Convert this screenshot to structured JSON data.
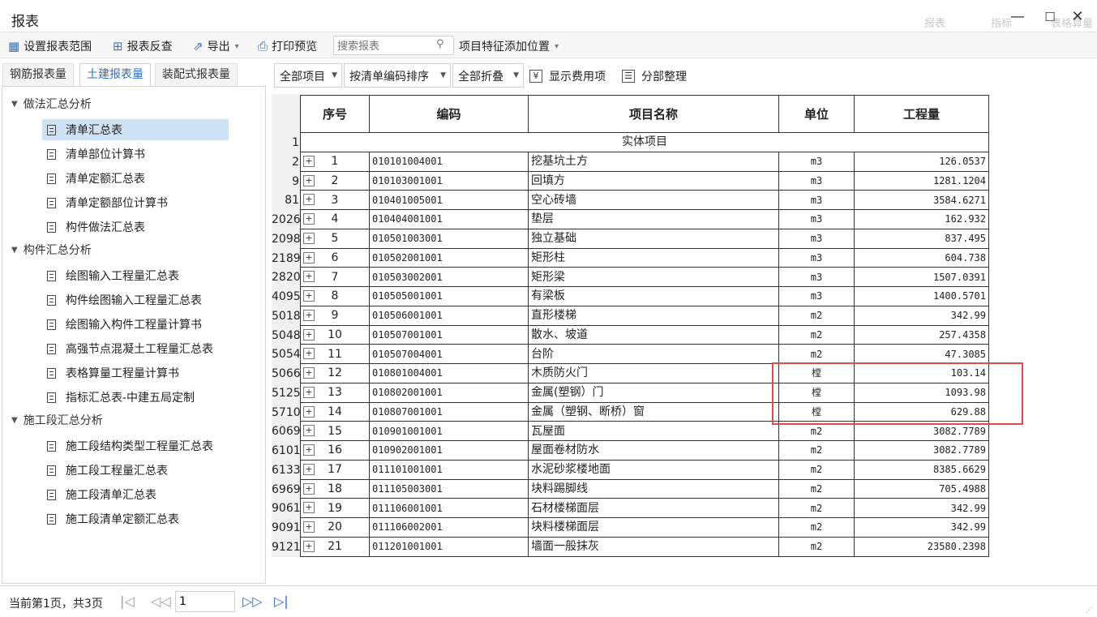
{
  "window": {
    "title": "报表",
    "faint_labels": [
      "报表",
      "指标",
      "表格算量"
    ],
    "minimize_symbol": "—",
    "maximize_symbol": "☐",
    "close_symbol": "✕"
  },
  "toolbar": {
    "set_range": "设置报表范围",
    "review": "报表反查",
    "export": "导出",
    "print_preview": "打印预览",
    "search_placeholder": "搜索报表",
    "add_feature_position": "项目特征添加位置"
  },
  "left_tabs": [
    {
      "label": "钢筋报表量",
      "active": false
    },
    {
      "label": "土建报表量",
      "active": true
    },
    {
      "label": "装配式报表量",
      "active": false
    }
  ],
  "tree": {
    "groups": [
      {
        "label": "做法汇总分析",
        "items": [
          "清单汇总表",
          "清单部位计算书",
          "清单定额汇总表",
          "清单定额部位计算书",
          "构件做法汇总表"
        ]
      },
      {
        "label": "构件汇总分析",
        "items": [
          "绘图输入工程量汇总表",
          "构件绘图输入工程量汇总表",
          "绘图输入构件工程量计算书",
          "高强节点混凝土工程量汇总表",
          "表格算量工程量计算书",
          "指标汇总表-中建五局定制"
        ]
      },
      {
        "label": "施工段汇总分析",
        "items": [
          "施工段结构类型工程量汇总表",
          "施工段工程量汇总表",
          "施工段清单汇总表",
          "施工段清单定额汇总表"
        ]
      }
    ],
    "selected": "清单汇总表"
  },
  "right_toolbar": {
    "all_items": "全部项目",
    "sort": "按清单编码排序",
    "fold": "全部折叠",
    "show_fee_icon": "¥",
    "show_fee": "显示费用项",
    "organize": "分部整理"
  },
  "table": {
    "headers": [
      "序号",
      "编码",
      "项目名称",
      "单位",
      "工程量"
    ],
    "section_rownum": "1",
    "section_label": "实体项目",
    "expand_symbol": "+",
    "rows": [
      {
        "rownum": "2",
        "seq": "1",
        "code": "010101004001",
        "name": "挖基坑土方",
        "unit": "m3",
        "qty": "126.0537"
      },
      {
        "rownum": "9",
        "seq": "2",
        "code": "010103001001",
        "name": "回填方",
        "unit": "m3",
        "qty": "1281.1204"
      },
      {
        "rownum": "81",
        "seq": "3",
        "code": "010401005001",
        "name": "空心砖墙",
        "unit": "m3",
        "qty": "3584.6271"
      },
      {
        "rownum": "2026",
        "seq": "4",
        "code": "010404001001",
        "name": "垫层",
        "unit": "m3",
        "qty": "162.932"
      },
      {
        "rownum": "2098",
        "seq": "5",
        "code": "010501003001",
        "name": "独立基础",
        "unit": "m3",
        "qty": "837.495"
      },
      {
        "rownum": "2189",
        "seq": "6",
        "code": "010502001001",
        "name": "矩形柱",
        "unit": "m3",
        "qty": "604.738"
      },
      {
        "rownum": "2820",
        "seq": "7",
        "code": "010503002001",
        "name": "矩形梁",
        "unit": "m3",
        "qty": "1507.0391"
      },
      {
        "rownum": "4095",
        "seq": "8",
        "code": "010505001001",
        "name": "有梁板",
        "unit": "m3",
        "qty": "1400.5701"
      },
      {
        "rownum": "5018",
        "seq": "9",
        "code": "010506001001",
        "name": "直形楼梯",
        "unit": "m2",
        "qty": "342.99"
      },
      {
        "rownum": "5048",
        "seq": "10",
        "code": "010507001001",
        "name": "散水、坡道",
        "unit": "m2",
        "qty": "257.4358"
      },
      {
        "rownum": "5054",
        "seq": "11",
        "code": "010507004001",
        "name": "台阶",
        "unit": "m2",
        "qty": "47.3085"
      },
      {
        "rownum": "5066",
        "seq": "12",
        "code": "010801004001",
        "name": "木质防火门",
        "unit": "樘",
        "qty": "103.14"
      },
      {
        "rownum": "5125",
        "seq": "13",
        "code": "010802001001",
        "name": "金属(塑钢）门",
        "unit": "樘",
        "qty": "1093.98"
      },
      {
        "rownum": "5710",
        "seq": "14",
        "code": "010807001001",
        "name": "金属（塑钢、断桥）窗",
        "unit": "樘",
        "qty": "629.88"
      },
      {
        "rownum": "6069",
        "seq": "15",
        "code": "010901001001",
        "name": "瓦屋面",
        "unit": "m2",
        "qty": "3082.7789"
      },
      {
        "rownum": "6101",
        "seq": "16",
        "code": "010902001001",
        "name": "屋面卷材防水",
        "unit": "m2",
        "qty": "3082.7789"
      },
      {
        "rownum": "6133",
        "seq": "17",
        "code": "011101001001",
        "name": "水泥砂浆楼地面",
        "unit": "m2",
        "qty": "8385.6629"
      },
      {
        "rownum": "6969",
        "seq": "18",
        "code": "011105003001",
        "name": "块料踢脚线",
        "unit": "m2",
        "qty": "705.4988"
      },
      {
        "rownum": "9061",
        "seq": "19",
        "code": "011106001001",
        "name": "石材楼梯面层",
        "unit": "m2",
        "qty": "342.99"
      },
      {
        "rownum": "9091",
        "seq": "20",
        "code": "011106002001",
        "name": "块料楼梯面层",
        "unit": "m2",
        "qty": "342.99"
      },
      {
        "rownum": "9121",
        "seq": "21",
        "code": "011201001001",
        "name": "墙面一般抹灰",
        "unit": "m2",
        "qty": "23580.2398"
      }
    ]
  },
  "status": {
    "page_info": "当前第1页，共3页",
    "page_input": "1"
  },
  "colors": {
    "accent": "#2a6fd2",
    "highlight_border": "#e04a4a",
    "selected_bg": "#cfe3f7"
  }
}
